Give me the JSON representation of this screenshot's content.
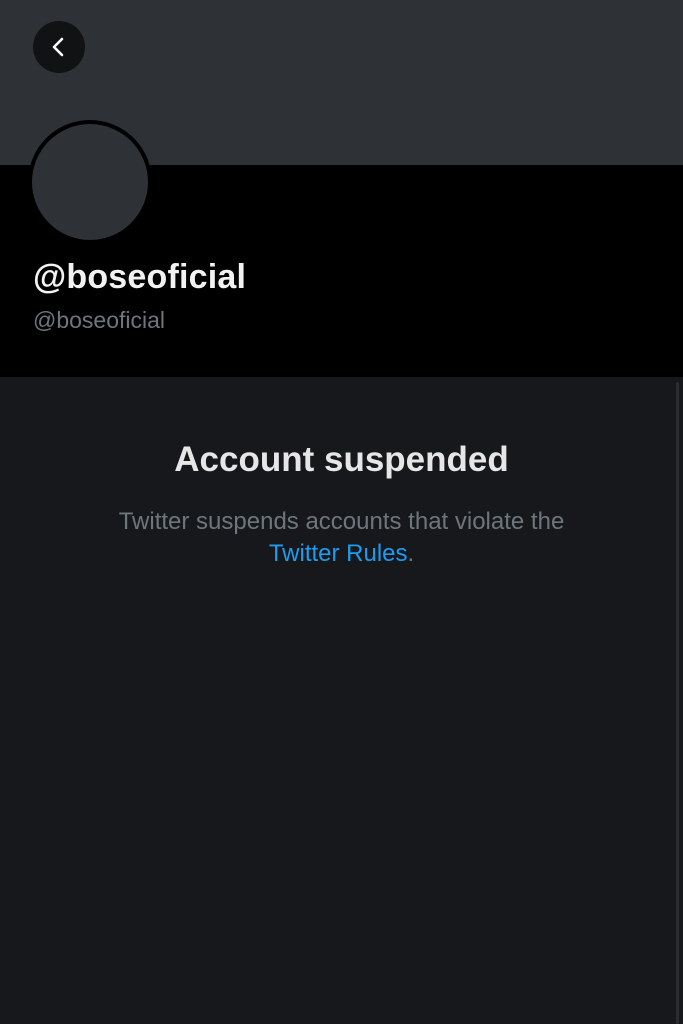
{
  "header": {
    "back_icon": "chevron-left-icon"
  },
  "profile": {
    "display_name": "@boseoficial",
    "handle": "@boseoficial"
  },
  "suspension": {
    "title": "Account suspended",
    "description_prefix": "Twitter suspends accounts that violate the",
    "link_label": "Twitter Rules",
    "description_suffix": "."
  },
  "colors": {
    "background": "#17181b",
    "banner": "#2e3135",
    "profile_block": "#000000",
    "link": "#1d9bf0",
    "muted_text": "#6e767d"
  }
}
